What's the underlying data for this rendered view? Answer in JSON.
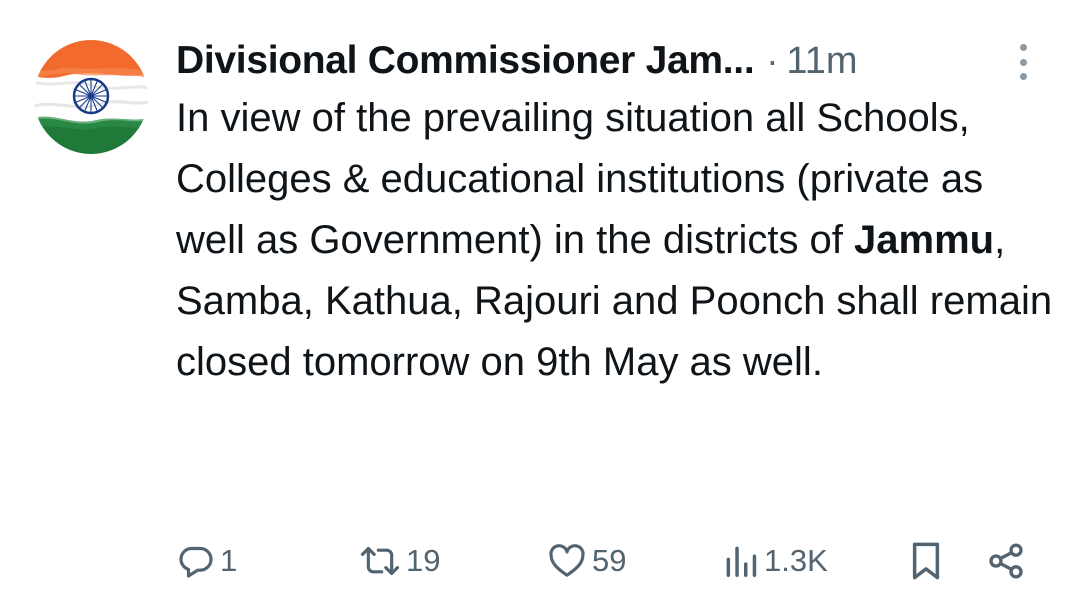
{
  "tweet": {
    "author_name": "Divisional Commissioner Jam...",
    "separator": "·",
    "time": "11m",
    "avatar_icon": "india-flag-icon",
    "text_parts": [
      "In view of the prevailing situation all Schools, Colleges & educational institutions (private as well as Government) in the districts of ",
      "Jammu",
      ", Samba, Kathua, Rajouri and Poonch shall remain closed tomorrow on 9th May as well."
    ]
  },
  "actions": {
    "reply_count": "1",
    "retweet_count": "19",
    "like_count": "59",
    "views_count": "1.3K"
  },
  "colors": {
    "text": "#0f1419",
    "muted": "#536471",
    "saffron": "#f26a2e",
    "green": "#1f7a3a",
    "chakra": "#1a3a8a"
  }
}
